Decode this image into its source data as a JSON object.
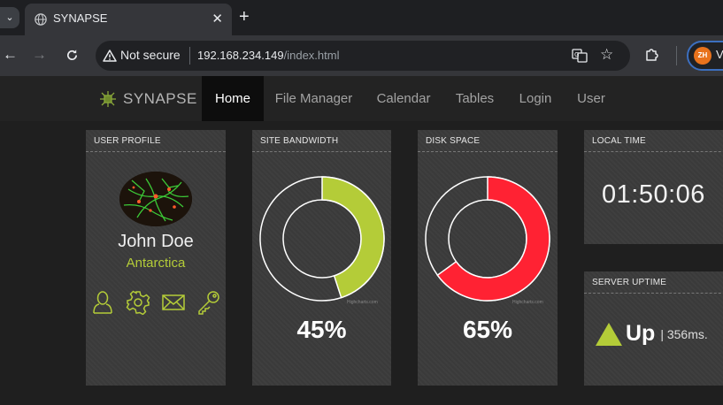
{
  "browser": {
    "tab_title": "SYNAPSE",
    "close_glyph": "✕",
    "new_tab_glyph": "+",
    "security_label": "Not secure",
    "url_host": "192.168.234.149",
    "url_path": "/index.html",
    "profile_initials": "ZH",
    "profile_label": "V"
  },
  "site": {
    "brand": "SYNAPSE",
    "nav": [
      "Home",
      "File Manager",
      "Calendar",
      "Tables",
      "Login",
      "User"
    ],
    "active_nav": "Home"
  },
  "user_profile": {
    "title": "USER PROFILE",
    "name": "John Doe",
    "location": "Antarctica",
    "icons": [
      "user-icon",
      "gear-icon",
      "mail-icon",
      "key-icon"
    ]
  },
  "bandwidth": {
    "title": "SITE BANDWIDTH",
    "percent_label": "45%",
    "value": 45,
    "color": "#b4cc38",
    "credit": "Highcharts.com"
  },
  "disk": {
    "title": "DISK SPACE",
    "percent_label": "65%",
    "value": 65,
    "color": "#ff2233",
    "credit": "Highcharts.com"
  },
  "local_time": {
    "title": "LOCAL TIME",
    "time": "01:50:06"
  },
  "server_uptime": {
    "title": "SERVER UPTIME",
    "status": "Up",
    "latency": "| 356ms."
  },
  "colors": {
    "accent": "#b4cc38",
    "panel": "#3a3a3a",
    "danger": "#ff2233"
  }
}
